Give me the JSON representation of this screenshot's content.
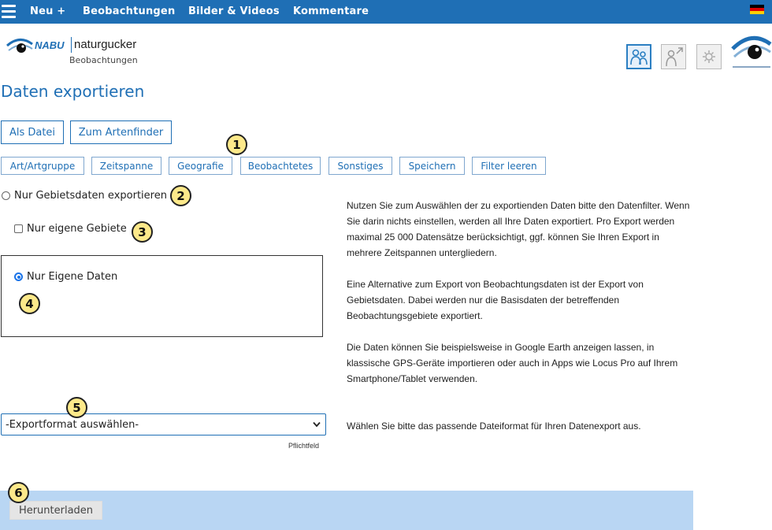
{
  "nav": {
    "items": [
      {
        "label": "Neu +"
      },
      {
        "label": "Beobachtungen"
      },
      {
        "label": "Bilder & Videos"
      },
      {
        "label": "Kommentare"
      }
    ],
    "flag_colors": [
      "#000000",
      "#dd0000",
      "#ffce00"
    ]
  },
  "logo": {
    "brand": "NABU",
    "name": "naturgucker",
    "subtitle": "Beobachtungen"
  },
  "header_icons": [
    "people-icon",
    "user-link-icon",
    "settings-icon"
  ],
  "page": {
    "title": "Daten exportieren"
  },
  "export_buttons": {
    "file": "Als Datei",
    "artenfinder": "Zum Artenfinder"
  },
  "filters": [
    {
      "label": "Art/Artgruppe"
    },
    {
      "label": "Zeitspanne"
    },
    {
      "label": "Geografie"
    },
    {
      "label": "Beobachtetes"
    },
    {
      "label": "Sonstiges"
    },
    {
      "label": "Speichern"
    },
    {
      "label": "Filter leeren"
    }
  ],
  "options": {
    "area_data": {
      "label": "Nur Gebietsdaten exportieren",
      "checked": false
    },
    "own_areas": {
      "label": "Nur eigene Gebiete",
      "checked": false
    },
    "own_data": {
      "label": "Nur Eigene Daten",
      "checked": true
    }
  },
  "help": {
    "p1": "Nutzen Sie zum Auswählen der zu exportienden Daten bitte den Datenfilter. Wenn Sie darin nichts einstellen, werden all Ihre Daten exportiert. Pro Export werden maximal 25 000 Datensätze berücksichtigt, ggf. können Sie Ihren Export in mehrere Zeitspannen untergliedern.",
    "p2": "Eine Alternative zum Export von Beobachtungsdaten ist der Export von Gebietsdaten. Dabei werden nur die Basisdaten der betreffenden Beobachtungsgebiete exportiert.",
    "p3": "Die Daten können Sie beispielsweise in Google Earth anzeigen lassen, in klassische GPS-Geräte importieren oder auch in Apps wie Locus Pro auf Ihrem Smartphone/Tablet verwenden.",
    "format": "Wählen Sie bitte das passende Dateiformat für Ihren Datenexport aus."
  },
  "format": {
    "selected": "-Exportformat auswählen-",
    "required": "Pflichtfeld"
  },
  "download": {
    "label": "Herunterladen"
  },
  "badges": [
    "1",
    "2",
    "3",
    "4",
    "5",
    "6"
  ],
  "colors": {
    "primary": "#1f6fb5",
    "badge": "#fde98a",
    "footer": "#b9d6f3",
    "radio": "#1a73e8"
  }
}
